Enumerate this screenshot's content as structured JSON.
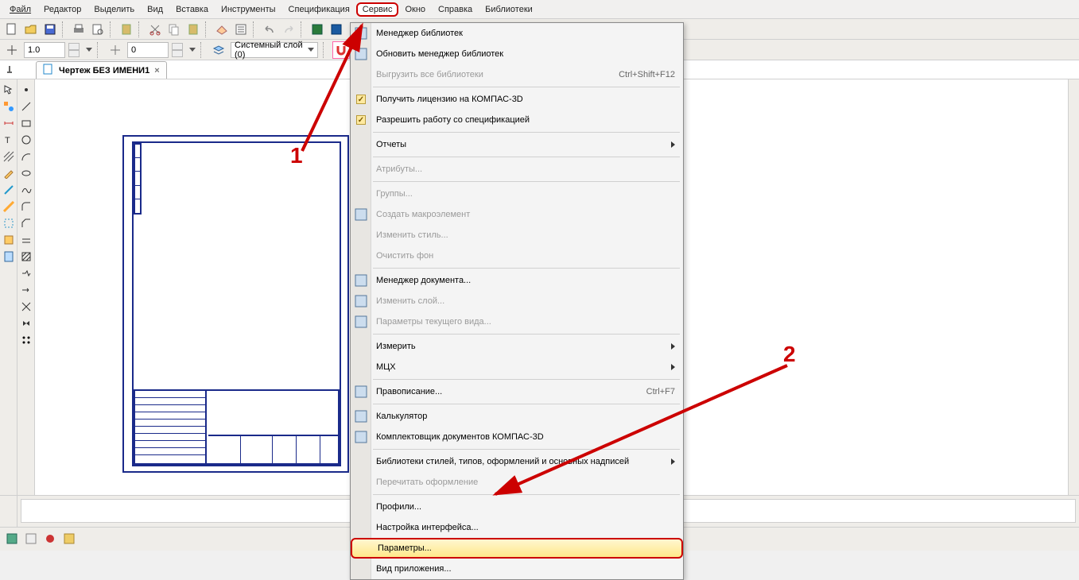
{
  "menubar": {
    "items": [
      "Файл",
      "Редактор",
      "Выделить",
      "Вид",
      "Вставка",
      "Инструменты",
      "Спецификация",
      "Сервис",
      "Окно",
      "Справка",
      "Библиотеки"
    ],
    "highlighted_index": 7
  },
  "secondary_bar": {
    "zoom_value": "1.0",
    "step_value": "0",
    "layer_label": "Системный слой (0)"
  },
  "document_tab": {
    "title": "Чертеж БЕЗ ИМЕНИ1"
  },
  "dropdown": {
    "items": [
      {
        "label": "Менеджер библиотек",
        "icon": "library-manager-icon"
      },
      {
        "label": "Обновить менеджер библиотек",
        "icon": "refresh-library-icon"
      },
      {
        "label": "Выгрузить все библиотеки",
        "disabled": true,
        "shortcut": "Ctrl+Shift+F12"
      },
      {
        "sep": true
      },
      {
        "label": "Получить лицензию на КОМПАС-3D",
        "check": true
      },
      {
        "label": "Разрешить работу со спецификацией",
        "check": true
      },
      {
        "sep": true
      },
      {
        "label": "Отчеты",
        "submenu": true
      },
      {
        "sep": true
      },
      {
        "label": "Атрибуты...",
        "disabled": true
      },
      {
        "sep": true
      },
      {
        "label": "Группы...",
        "disabled": true
      },
      {
        "label": "Создать макроэлемент",
        "disabled": true,
        "icon": "macro-icon"
      },
      {
        "label": "Изменить стиль...",
        "disabled": true
      },
      {
        "label": "Очистить фон",
        "disabled": true
      },
      {
        "sep": true
      },
      {
        "label": "Менеджер документа...",
        "icon": "doc-manager-icon"
      },
      {
        "label": "Изменить слой...",
        "disabled": true,
        "icon": "layer-icon"
      },
      {
        "label": "Параметры текущего вида...",
        "disabled": true,
        "icon": "view-params-icon"
      },
      {
        "sep": true
      },
      {
        "label": "Измерить",
        "submenu": true
      },
      {
        "label": "МЦХ",
        "submenu": true
      },
      {
        "sep": true
      },
      {
        "label": "Правописание...",
        "shortcut": "Ctrl+F7",
        "icon": "spellcheck-icon"
      },
      {
        "sep": true
      },
      {
        "label": "Калькулятор",
        "icon": "calculator-icon"
      },
      {
        "label": "Комплектовщик документов КОМПАС-3D",
        "icon": "bundler-icon"
      },
      {
        "sep": true
      },
      {
        "label": "Библиотеки стилей, типов, оформлений и основных надписей",
        "submenu": true
      },
      {
        "label": "Перечитать оформление",
        "disabled": true
      },
      {
        "sep": true
      },
      {
        "label": "Профили..."
      },
      {
        "label": "Настройка интерфейса..."
      },
      {
        "label": "Параметры...",
        "highlighted": true
      },
      {
        "label": "Вид приложения..."
      }
    ]
  },
  "annotations": {
    "label1": "1",
    "label2": "2"
  }
}
